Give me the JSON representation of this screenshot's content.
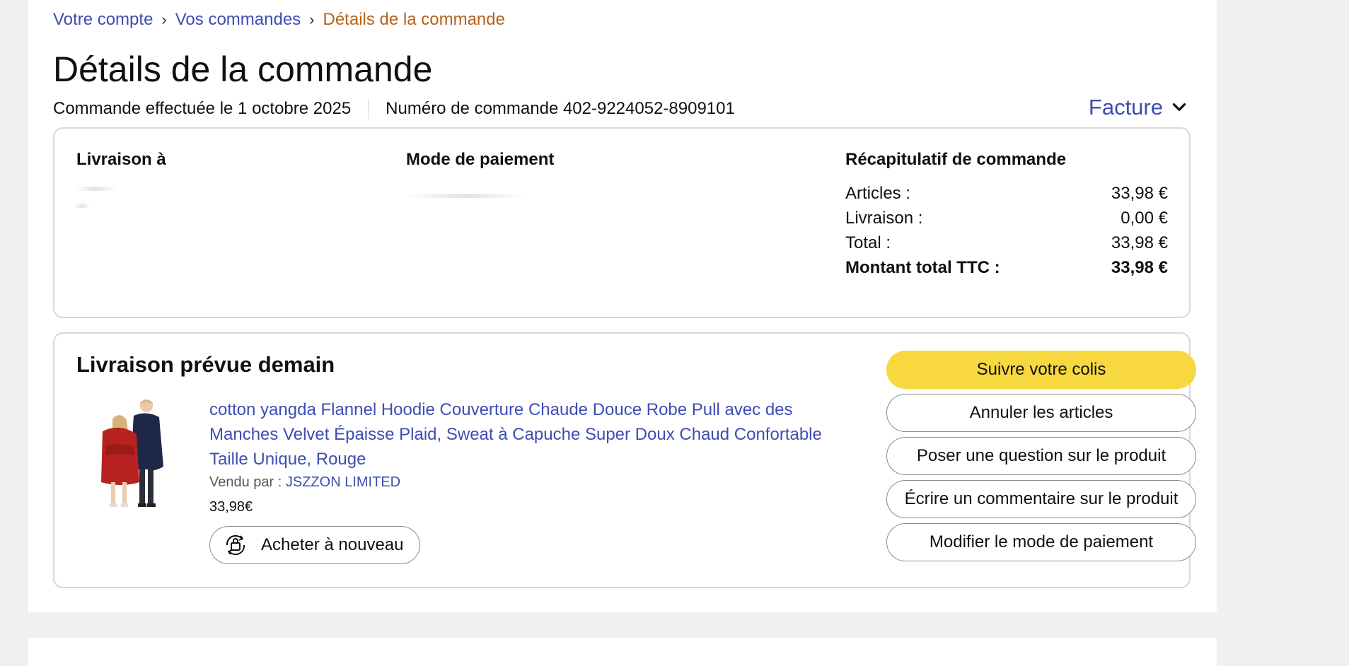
{
  "breadcrumb": {
    "account": "Votre compte",
    "separator": "›",
    "orders": "Vos commandes",
    "current": "Détails de la commande"
  },
  "page_title": "Détails de la commande",
  "order_meta": {
    "placed": "Commande effectuée le 1 octobre 2025",
    "number": "Numéro de commande 402-9224052-8909101"
  },
  "invoice": {
    "label": "Facture",
    "icon": "chevron-down-icon"
  },
  "order_info": {
    "shipping_header": "Livraison à",
    "payment_header": "Mode de paiement",
    "summary_header": "Récapitulatif de commande",
    "summary_rows": [
      {
        "label": "Articles :",
        "value": "33,98 €"
      },
      {
        "label": "Livraison :",
        "value": "0,00 €"
      },
      {
        "label": "Total :",
        "value": "33,98 €"
      },
      {
        "label": "Montant total TTC :",
        "value": "33,98 €"
      }
    ]
  },
  "delivery": {
    "title": "Livraison prévue demain",
    "product": {
      "title": "cotton yangda Flannel Hoodie Couverture Chaude Douce Robe Pull avec des Manches Velvet Épaisse Plaid, Sweat à Capuche Super Doux Chaud Confortable Taille Unique, Rouge",
      "seller_prefix": "Vendu par  :",
      "seller_name": "JSZZON LIMITED",
      "price": "33,98€"
    },
    "buy_again": "Acheter à nouveau",
    "actions": [
      "Suivre votre colis",
      "Annuler les articles",
      "Poser une question sur le produit",
      "Écrire un commentaire sur le produit",
      "Modifier le mode de paiement"
    ]
  },
  "colors": {
    "link": "#3d4db3",
    "breadcrumb_current": "#b5621b",
    "primary_button": "#f7d83f",
    "border": "#d5d9d9",
    "background": "#eff1f0"
  }
}
